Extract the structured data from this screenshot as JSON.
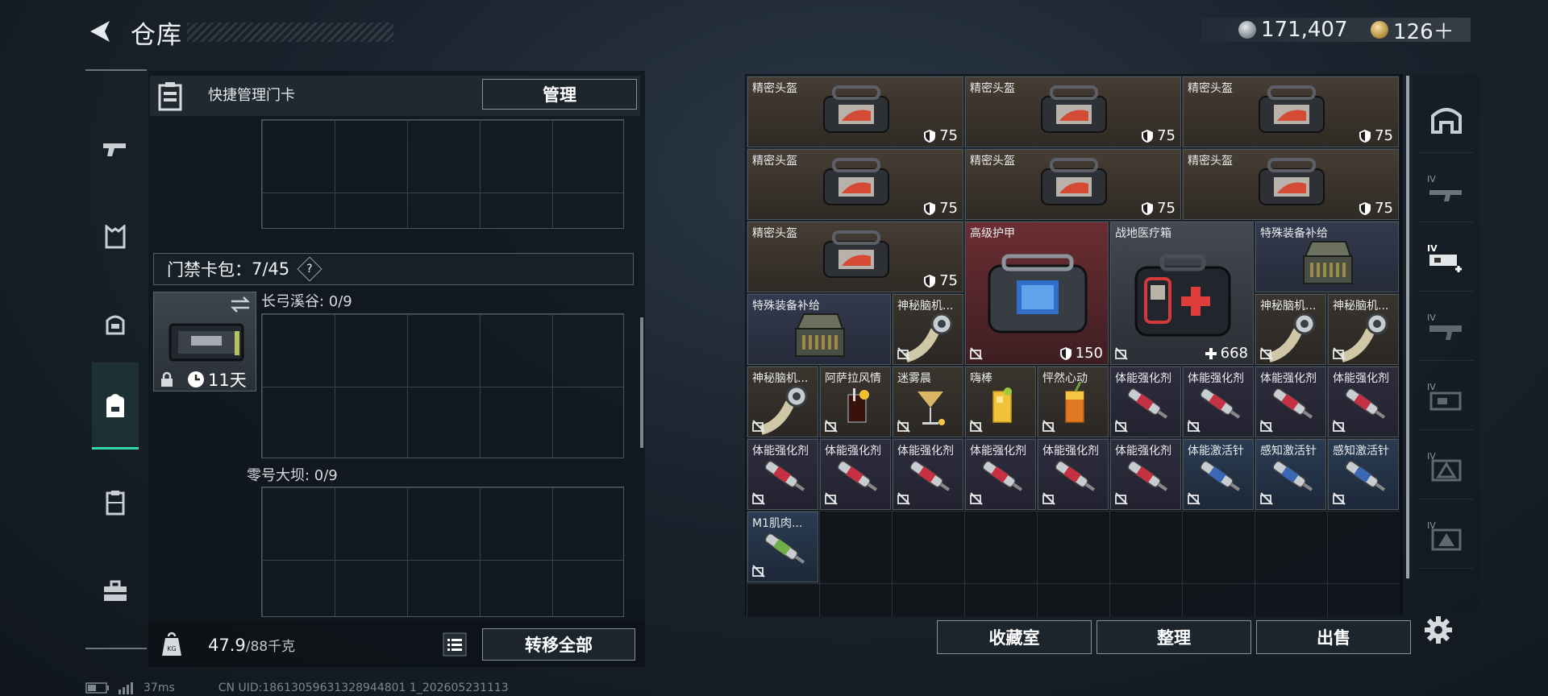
{
  "header": {
    "title": "仓库",
    "currency": [
      {
        "name": "coin-silver",
        "value": "171,407"
      },
      {
        "name": "coin-gold",
        "value": "126＋"
      }
    ]
  },
  "left_tabs": [
    {
      "name": "weapon",
      "icon": "gun-icon"
    },
    {
      "name": "armor",
      "icon": "vest-icon"
    },
    {
      "name": "helmet",
      "icon": "helmet-icon"
    },
    {
      "name": "backpack",
      "icon": "backpack-icon",
      "active": true
    },
    {
      "name": "chest-rig",
      "icon": "chestrig-icon"
    },
    {
      "name": "toolbox",
      "icon": "toolbox-icon"
    }
  ],
  "card_manager": {
    "label": "快捷管理门卡",
    "manage_button": "管理"
  },
  "keycard_bag": {
    "label": "门禁卡包：",
    "count": "7/45",
    "help": "?",
    "timer": "11天"
  },
  "sections": [
    {
      "label": "长弓溪谷: 0/9"
    },
    {
      "label": "零号大坝: 0/9"
    }
  ],
  "bottom_left": {
    "weight": "47.9",
    "weight_unit": "/88千克",
    "transfer_button": "转移全部"
  },
  "stash_items": [
    {
      "name": "精密头盔",
      "value": "75",
      "icon": "shield-icon",
      "type": "helmet"
    },
    {
      "name": "精密头盔",
      "value": "75",
      "icon": "shield-icon",
      "type": "helmet"
    },
    {
      "name": "精密头盔",
      "value": "75",
      "icon": "shield-icon",
      "type": "helmet"
    },
    {
      "name": "精密头盔",
      "value": "75",
      "icon": "shield-icon",
      "type": "helmet"
    },
    {
      "name": "精密头盔",
      "value": "75",
      "icon": "shield-icon",
      "type": "helmet"
    },
    {
      "name": "精密头盔",
      "value": "75",
      "icon": "shield-icon",
      "type": "helmet"
    },
    {
      "name": "精密头盔",
      "value": "75",
      "icon": "shield-icon",
      "type": "helmet"
    },
    {
      "name": "高级护甲",
      "value": "150",
      "icon": "shield-icon",
      "type": "armor"
    },
    {
      "name": "战地医疗箱",
      "value": "668",
      "icon": "plus-icon",
      "type": "medkit"
    },
    {
      "name": "特殊装备补给",
      "type": "crate"
    },
    {
      "name": "特殊装备补给",
      "type": "crate"
    },
    {
      "name": "神秘脑机...",
      "type": "chip"
    },
    {
      "name": "神秘脑机...",
      "type": "chip"
    },
    {
      "name": "神秘脑机...",
      "type": "chip"
    },
    {
      "name": "神秘脑机...",
      "type": "chip"
    },
    {
      "name": "阿萨拉风情",
      "type": "drink-dark"
    },
    {
      "name": "迷雾晨",
      "type": "drink-martini"
    },
    {
      "name": "嗨棒",
      "type": "drink-yellow"
    },
    {
      "name": "怦然心动",
      "type": "drink-orange"
    },
    {
      "name": "体能强化剂",
      "type": "syringe-red"
    },
    {
      "name": "体能强化剂",
      "type": "syringe-red"
    },
    {
      "name": "体能强化剂",
      "type": "syringe-red"
    },
    {
      "name": "体能强化剂",
      "type": "syringe-red"
    },
    {
      "name": "体能强化剂",
      "type": "syringe-red"
    },
    {
      "name": "体能强化剂",
      "type": "syringe-red"
    },
    {
      "name": "体能强化剂",
      "type": "syringe-red"
    },
    {
      "name": "体能强化剂",
      "type": "syringe-red"
    },
    {
      "name": "体能强化剂",
      "type": "syringe-red"
    },
    {
      "name": "体能强化剂",
      "type": "syringe-red"
    },
    {
      "name": "体能激活针",
      "type": "syringe-blue"
    },
    {
      "name": "感知激活针",
      "type": "syringe-blue"
    },
    {
      "name": "感知激活针",
      "type": "syringe-blue"
    },
    {
      "name": "M1肌肉...",
      "type": "syringe-green"
    }
  ],
  "stash_footer": {
    "collection_button": "收藏室",
    "sort_button": "整理",
    "sell_button": "出售"
  },
  "filter_tabs": [
    {
      "name": "all",
      "icon": "storage-icon"
    },
    {
      "name": "iv-gun",
      "label": "IV"
    },
    {
      "name": "iv-gun-add",
      "label": "IV",
      "active": true
    },
    {
      "name": "iv-weapon",
      "label": "IV"
    },
    {
      "name": "iv-box",
      "label": "IV"
    },
    {
      "name": "iv-tri",
      "label": "IV"
    },
    {
      "name": "iv-tri2",
      "label": "IV"
    }
  ],
  "status": {
    "ping": "37ms",
    "uid": "CN UID:18613059631328944801 1_202605231113"
  },
  "colors": {
    "accent": "#2fd9a8",
    "helmet_bg": "#3d3630",
    "armor_bg": "#5a2a2c",
    "medkit_bg": "#3a3c44",
    "crate_bg": "#2c3140",
    "blue_item_bg": "#243448"
  }
}
